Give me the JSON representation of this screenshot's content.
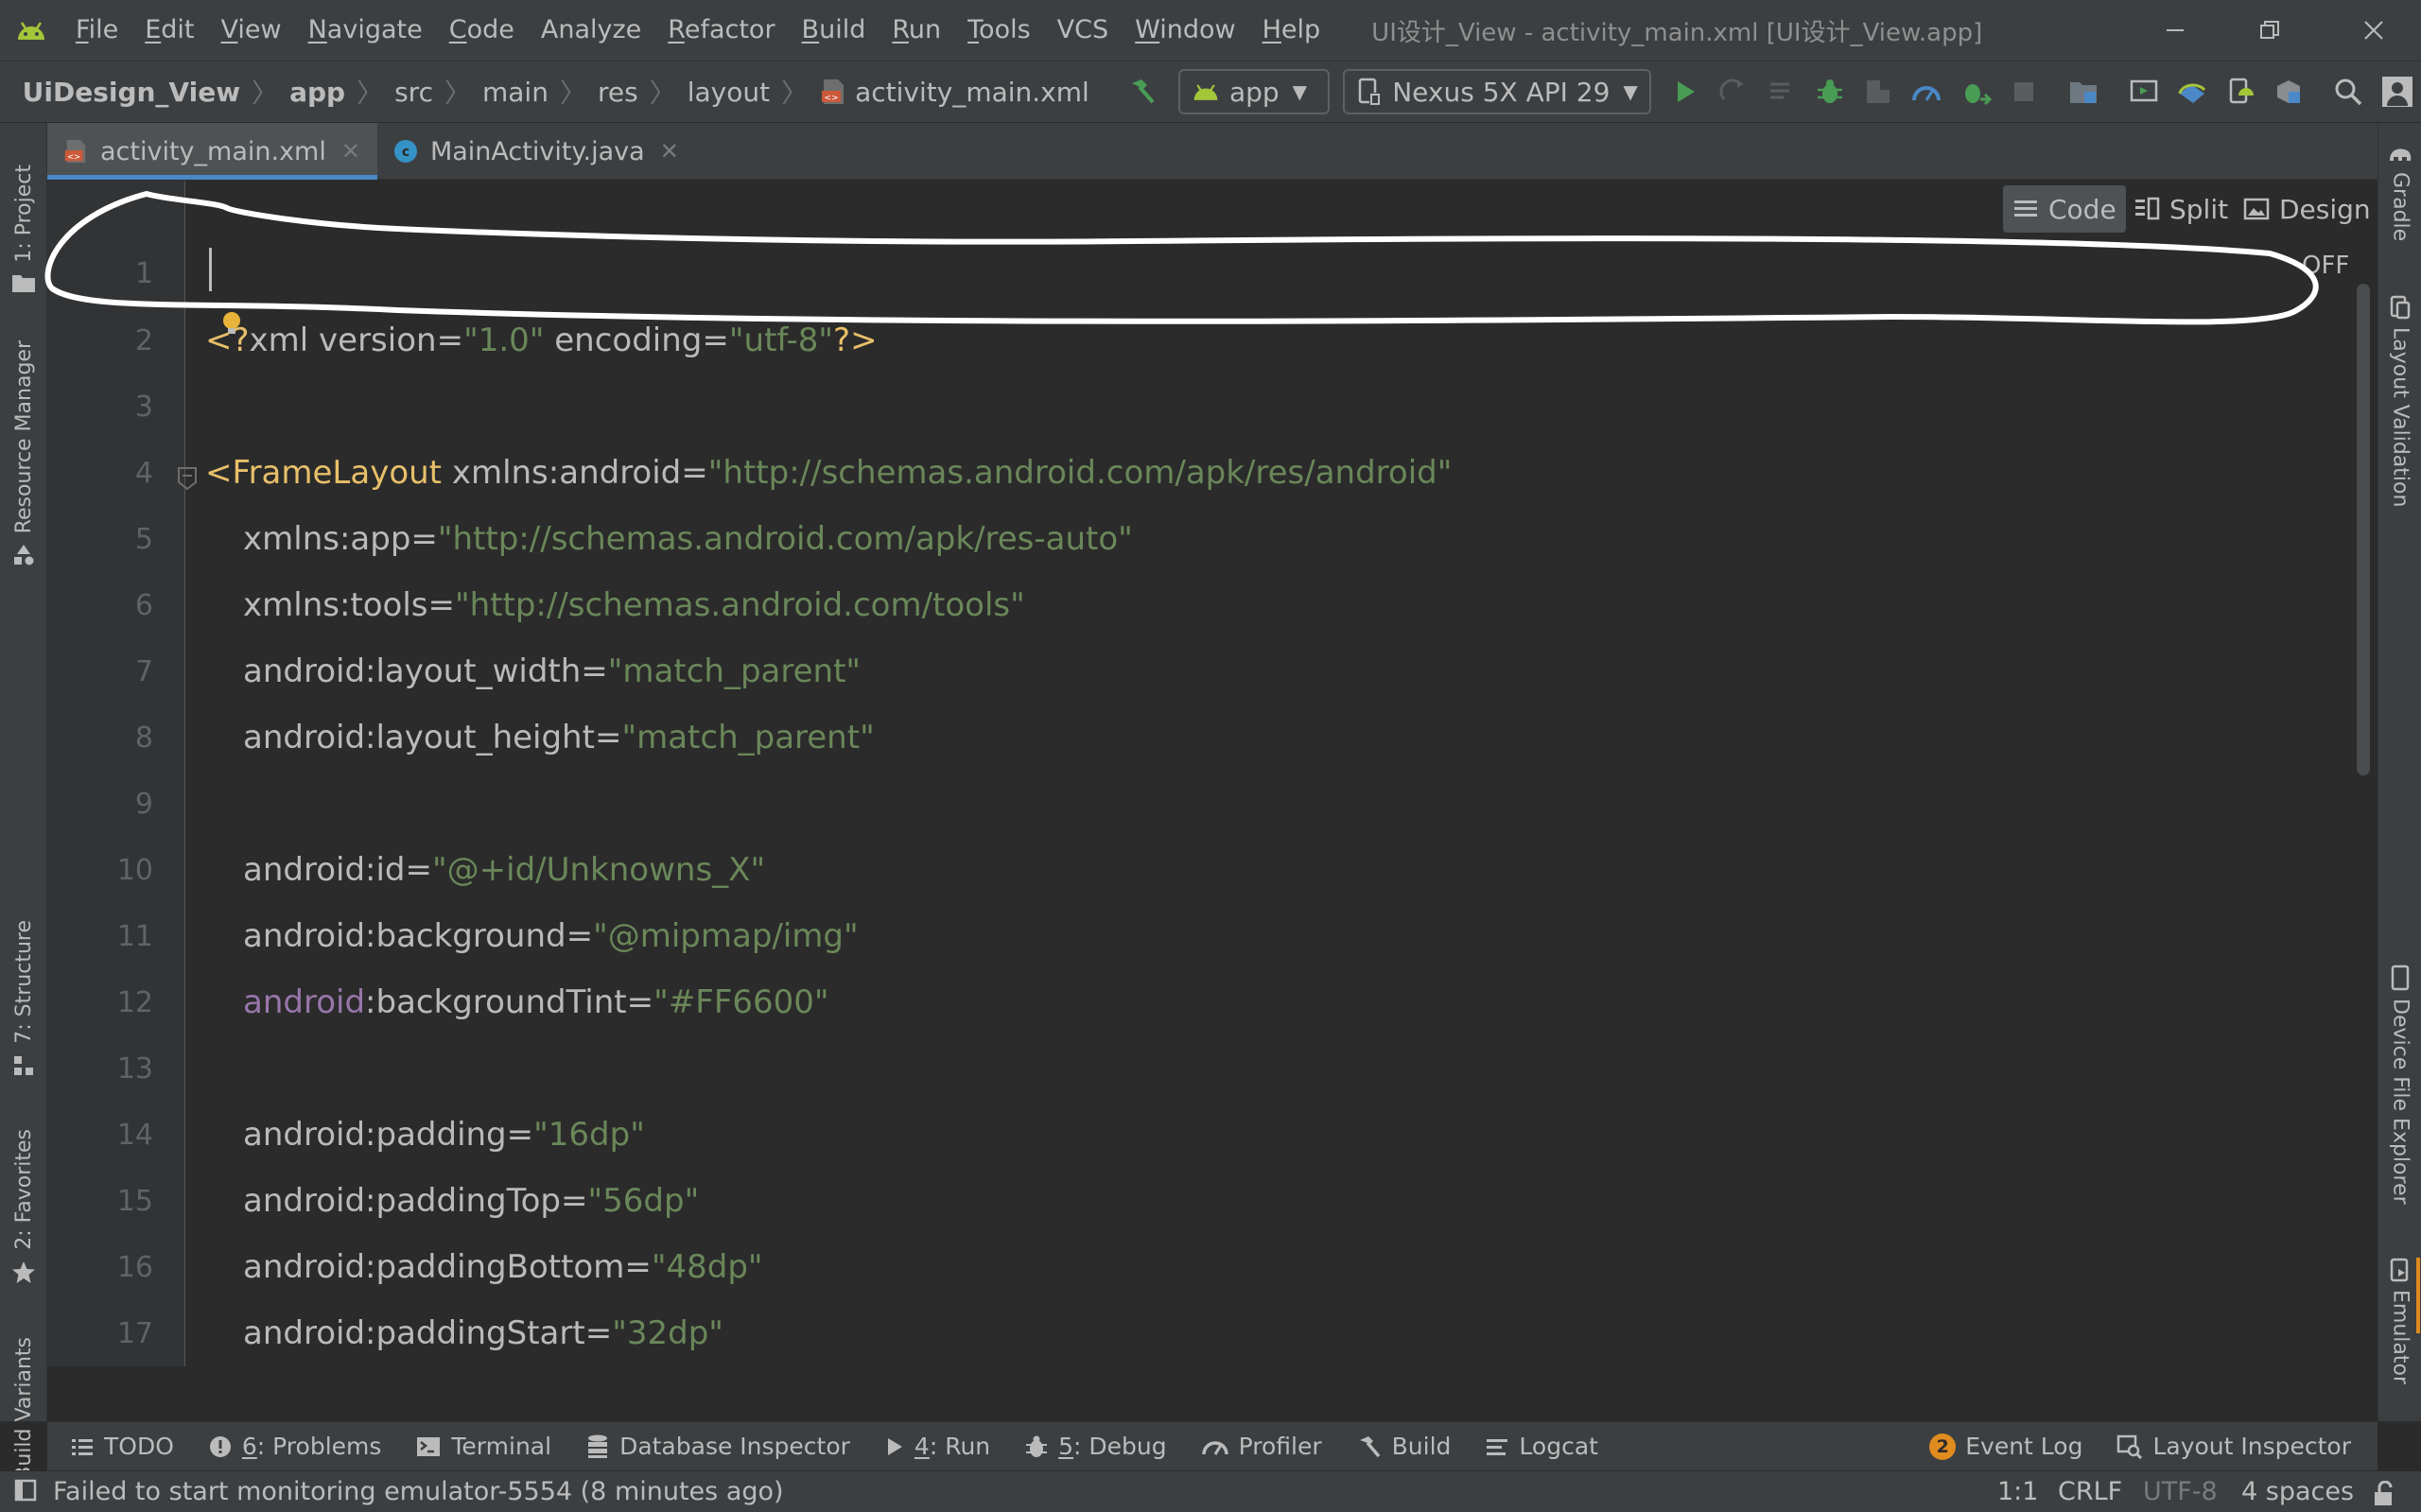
{
  "menu": {
    "items": [
      {
        "mnemonic": "F",
        "rest": "ile"
      },
      {
        "mnemonic": "E",
        "rest": "dit"
      },
      {
        "mnemonic": "V",
        "rest": "iew"
      },
      {
        "mnemonic": "N",
        "rest": "avigate"
      },
      {
        "mnemonic": "C",
        "rest": "ode"
      },
      {
        "mnemonic": "",
        "rest": "Analyze"
      },
      {
        "mnemonic": "R",
        "rest": "efactor"
      },
      {
        "mnemonic": "B",
        "rest": "uild"
      },
      {
        "mnemonic": "R",
        "rest": "un"
      },
      {
        "mnemonic": "T",
        "rest": "ools"
      },
      {
        "mnemonic": "",
        "rest": "VCS"
      },
      {
        "mnemonic": "W",
        "rest": "indow"
      },
      {
        "mnemonic": "H",
        "rest": "elp"
      }
    ],
    "window_title": "UI设计_View - activity_main.xml [UI设计_View.app]"
  },
  "breadcrumbs": {
    "project": "UiDesign_View",
    "module": "app",
    "src": "src",
    "main": "main",
    "res": "res",
    "layout": "layout",
    "file": "activity_main.xml"
  },
  "toolbar": {
    "run_config": "app",
    "device": "Nexus 5X API 29"
  },
  "left_tools": {
    "project": "1: Project",
    "resource_manager": "Resource Manager",
    "structure": "7: Structure",
    "favorites": "2: Favorites",
    "build_variants": "Build Variants"
  },
  "right_tools": {
    "gradle": "Gradle",
    "layout_validation": "Layout Validation",
    "device_file_explorer": "Device File Explorer",
    "emulator": "Emulator"
  },
  "tabs": [
    {
      "label": "activity_main.xml"
    },
    {
      "label": "MainActivity.java"
    }
  ],
  "view_modes": {
    "code": "Code",
    "split": "Split",
    "design": "Design"
  },
  "editor": {
    "off_label": "OFF",
    "line_numbers": [
      "1",
      "2",
      "3",
      "4",
      "5",
      "6",
      "7",
      "8",
      "9",
      "10",
      "11",
      "12",
      "13",
      "14",
      "15",
      "16",
      "17"
    ],
    "lines": {
      "l2": {
        "open": "<",
        "q": "?",
        "name": "xml",
        "a1": " version",
        "v1": "\"1.0\"",
        "a2": " encoding",
        "v2": "\"utf-8\"",
        "close": "?>"
      },
      "l4": {
        "tag": "<FrameLayout",
        "attr": " xmlns:android",
        "val": "\"http://schemas.android.com/apk/res/android\""
      },
      "l5": {
        "attr": "xmlns:app",
        "val": "\"http://schemas.android.com/apk/res-auto\""
      },
      "l6": {
        "attr": "xmlns:tools",
        "val": "\"http://schemas.android.com/tools\""
      },
      "l7": {
        "attr": "android:layout_width",
        "val": "\"match_parent\""
      },
      "l8": {
        "attr": "android:layout_height",
        "val": "\"match_parent\""
      },
      "l10": {
        "attr": "android:id",
        "val": "\"@+id/Unknowns_X\""
      },
      "l11": {
        "attr": "android:background",
        "val": "\"@mipmap/img\""
      },
      "l12": {
        "ns": "android",
        "attr": ":backgroundTint",
        "val": "\"#FF6600\""
      },
      "l14": {
        "attr": "android:padding",
        "val": "\"16dp\""
      },
      "l15": {
        "attr": "android:paddingTop",
        "val": "\"56dp\""
      },
      "l16": {
        "attr": "android:paddingBottom",
        "val": "\"48dp\""
      },
      "l17": {
        "attr": "android:paddingStart",
        "val": "\"32dp\""
      }
    },
    "equals": "="
  },
  "bottom_tools": {
    "todo": "TODO",
    "problems_mn": "6",
    "problems": ": Problems",
    "terminal": "Terminal",
    "database_inspector": "Database Inspector",
    "run_mn": "4",
    "run": ": Run",
    "debug_mn": "5",
    "debug": ": Debug",
    "profiler": "Profiler",
    "build": "Build",
    "logcat": "Logcat",
    "event_log_count": "2",
    "event_log": "Event Log",
    "layout_inspector": "Layout Inspector"
  },
  "status": {
    "message": "Failed to start monitoring emulator-5554 (8 minutes ago)",
    "position": "1:1",
    "line_sep": "CRLF",
    "encoding": "UTF-8",
    "indent": "4 spaces"
  },
  "colors": {
    "android_green": "#a4c639",
    "run_green": "#499c54",
    "accent_blue": "#4a88c7",
    "xml_tag": "#e8bf6a",
    "xml_value": "#6a8759",
    "xml_ns": "#9876aa"
  },
  "icons": [
    "android-logo-icon",
    "build-hammer-icon",
    "run-icon",
    "debug-icon",
    "profile-icon",
    "stop-icon",
    "search-icon",
    "avatar-icon"
  ]
}
